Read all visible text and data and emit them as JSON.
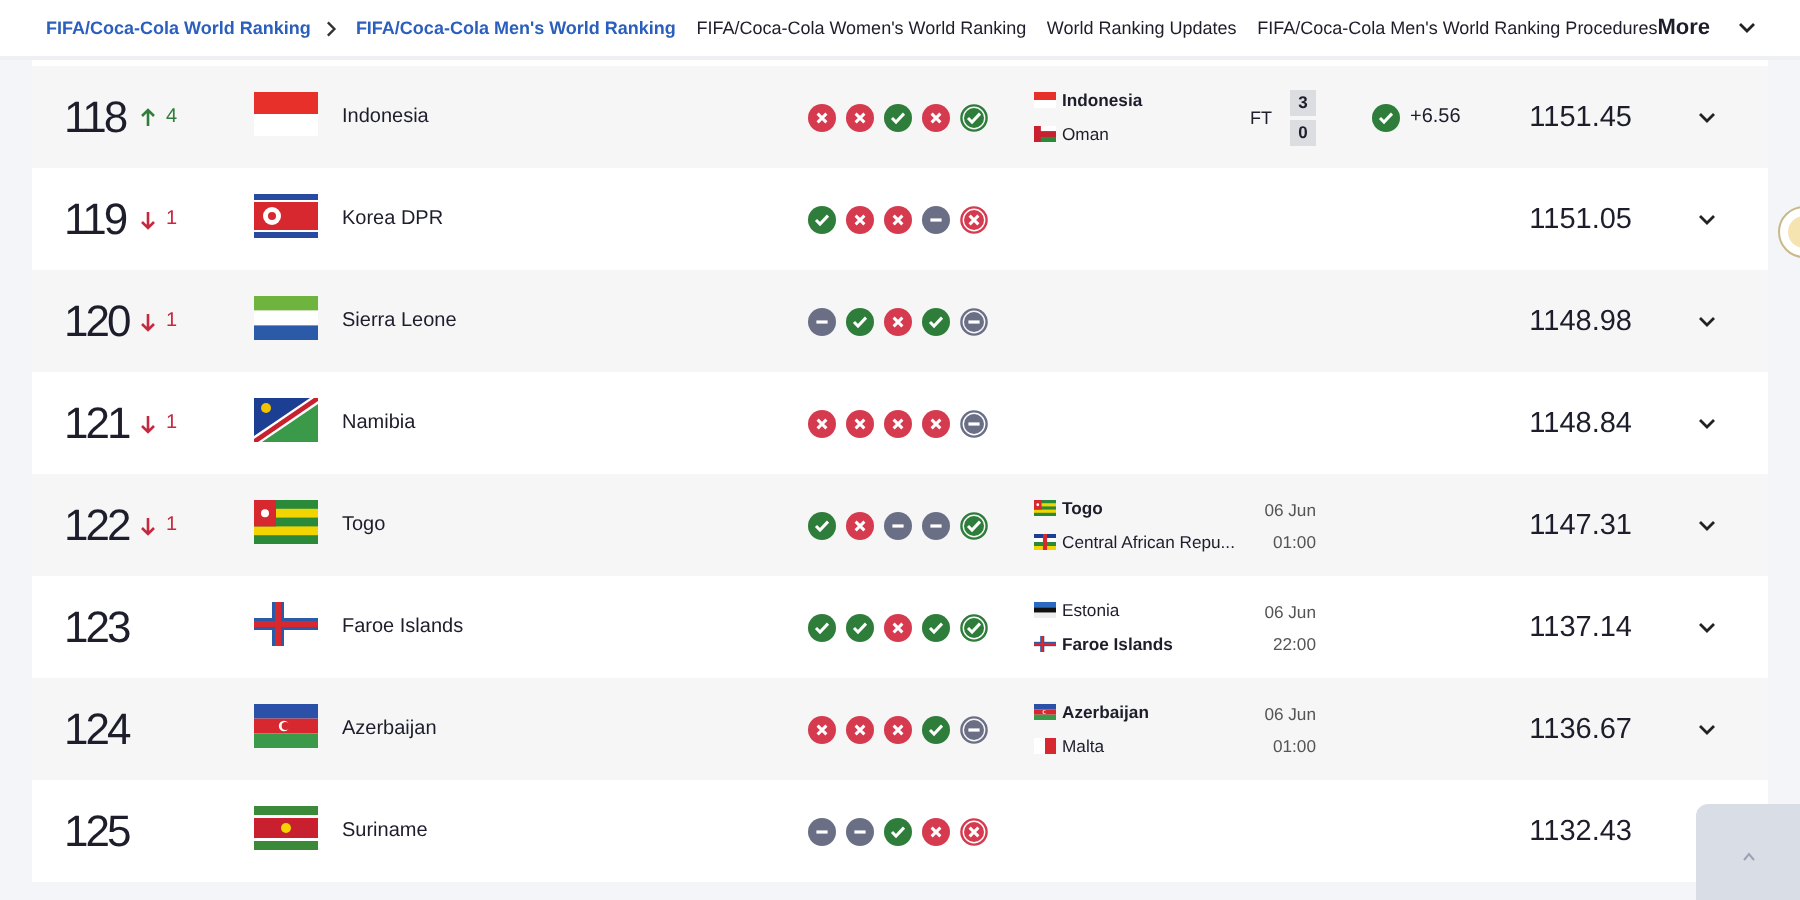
{
  "nav": {
    "items": [
      {
        "label": "FIFA/Coca-Cola World Ranking",
        "kind": "breadcrumb"
      },
      {
        "label": "FIFA/Coca-Cola Men's World Ranking",
        "kind": "breadcrumb"
      },
      {
        "label": "FIFA/Coca-Cola Women's World Ranking",
        "kind": "link"
      },
      {
        "label": "World Ranking Updates",
        "kind": "link"
      },
      {
        "label": "FIFA/Coca-Cola Men's World Ranking Procedures",
        "kind": "link"
      }
    ],
    "more": "More"
  },
  "rows": [
    {
      "rank": "118",
      "change": {
        "kind": "up",
        "value": "4"
      },
      "flag": {
        "kind": "idn"
      },
      "team": "Indonesia",
      "form": [
        {
          "kind": "loss",
          "latest": false
        },
        {
          "kind": "loss",
          "latest": false
        },
        {
          "kind": "win",
          "latest": false
        },
        {
          "kind": "loss",
          "latest": false
        },
        {
          "kind": "win",
          "latest": true
        }
      ],
      "match": {
        "teams": [
          {
            "name": "Indonesia",
            "flag": {
              "kind": "idn"
            },
            "bold": true
          },
          {
            "name": "Oman",
            "flag": {
              "kind": "omn"
            },
            "bold": false
          }
        ],
        "status": "FT",
        "scores": [
          "3",
          "0"
        ]
      },
      "delta": {
        "kind": "win",
        "value": "+6.56"
      },
      "points": "1151.45"
    },
    {
      "rank": "119",
      "change": {
        "kind": "down",
        "value": "1"
      },
      "flag": {
        "kind": "prk"
      },
      "team": "Korea DPR",
      "form": [
        {
          "kind": "win",
          "latest": false
        },
        {
          "kind": "loss",
          "latest": false
        },
        {
          "kind": "loss",
          "latest": false
        },
        {
          "kind": "draw",
          "latest": false
        },
        {
          "kind": "loss",
          "latest": true
        }
      ],
      "points": "1151.05"
    },
    {
      "rank": "120",
      "change": {
        "kind": "down",
        "value": "1"
      },
      "flag": {
        "kind": "sle"
      },
      "team": "Sierra Leone",
      "form": [
        {
          "kind": "draw",
          "latest": false
        },
        {
          "kind": "win",
          "latest": false
        },
        {
          "kind": "loss",
          "latest": false
        },
        {
          "kind": "win",
          "latest": false
        },
        {
          "kind": "draw",
          "latest": true
        }
      ],
      "points": "1148.98"
    },
    {
      "rank": "121",
      "change": {
        "kind": "down",
        "value": "1"
      },
      "flag": {
        "kind": "nam"
      },
      "team": "Namibia",
      "form": [
        {
          "kind": "loss",
          "latest": false
        },
        {
          "kind": "loss",
          "latest": false
        },
        {
          "kind": "loss",
          "latest": false
        },
        {
          "kind": "loss",
          "latest": false
        },
        {
          "kind": "draw",
          "latest": true
        }
      ],
      "points": "1148.84"
    },
    {
      "rank": "122",
      "change": {
        "kind": "down",
        "value": "1"
      },
      "flag": {
        "kind": "tgo"
      },
      "team": "Togo",
      "form": [
        {
          "kind": "win",
          "latest": false
        },
        {
          "kind": "loss",
          "latest": false
        },
        {
          "kind": "draw",
          "latest": false
        },
        {
          "kind": "draw",
          "latest": false
        },
        {
          "kind": "win",
          "latest": true
        }
      ],
      "match": {
        "teams": [
          {
            "name": "Togo",
            "flag": {
              "kind": "tgo"
            },
            "bold": true
          },
          {
            "name": "Central African Repu...",
            "flag": {
              "kind": "caf"
            },
            "bold": false
          }
        ],
        "date": "06 Jun",
        "time": "01:00"
      },
      "points": "1147.31"
    },
    {
      "rank": "123",
      "flag": {
        "kind": "fro"
      },
      "team": "Faroe Islands",
      "form": [
        {
          "kind": "win",
          "latest": false
        },
        {
          "kind": "win",
          "latest": false
        },
        {
          "kind": "loss",
          "latest": false
        },
        {
          "kind": "win",
          "latest": false
        },
        {
          "kind": "win",
          "latest": true
        }
      ],
      "match": {
        "teams": [
          {
            "name": "Estonia",
            "flag": {
              "kind": "est"
            },
            "bold": false
          },
          {
            "name": "Faroe Islands",
            "flag": {
              "kind": "fro"
            },
            "bold": true
          }
        ],
        "date": "06 Jun",
        "time": "22:00"
      },
      "points": "1137.14"
    },
    {
      "rank": "124",
      "flag": {
        "kind": "aze"
      },
      "team": "Azerbaijan",
      "form": [
        {
          "kind": "loss",
          "latest": false
        },
        {
          "kind": "loss",
          "latest": false
        },
        {
          "kind": "loss",
          "latest": false
        },
        {
          "kind": "win",
          "latest": false
        },
        {
          "kind": "draw",
          "latest": true
        }
      ],
      "match": {
        "teams": [
          {
            "name": "Azerbaijan",
            "flag": {
              "kind": "aze"
            },
            "bold": true
          },
          {
            "name": "Malta",
            "flag": {
              "kind": "mlt"
            },
            "bold": false
          }
        ],
        "date": "06 Jun",
        "time": "01:00"
      },
      "points": "1136.67"
    },
    {
      "rank": "125",
      "flag": {
        "kind": "sur"
      },
      "team": "Suriname",
      "form": [
        {
          "kind": "draw",
          "latest": false
        },
        {
          "kind": "draw",
          "latest": false
        },
        {
          "kind": "win",
          "latest": false
        },
        {
          "kind": "loss",
          "latest": false
        },
        {
          "kind": "loss",
          "latest": true
        }
      ],
      "points": "1132.43"
    }
  ]
}
